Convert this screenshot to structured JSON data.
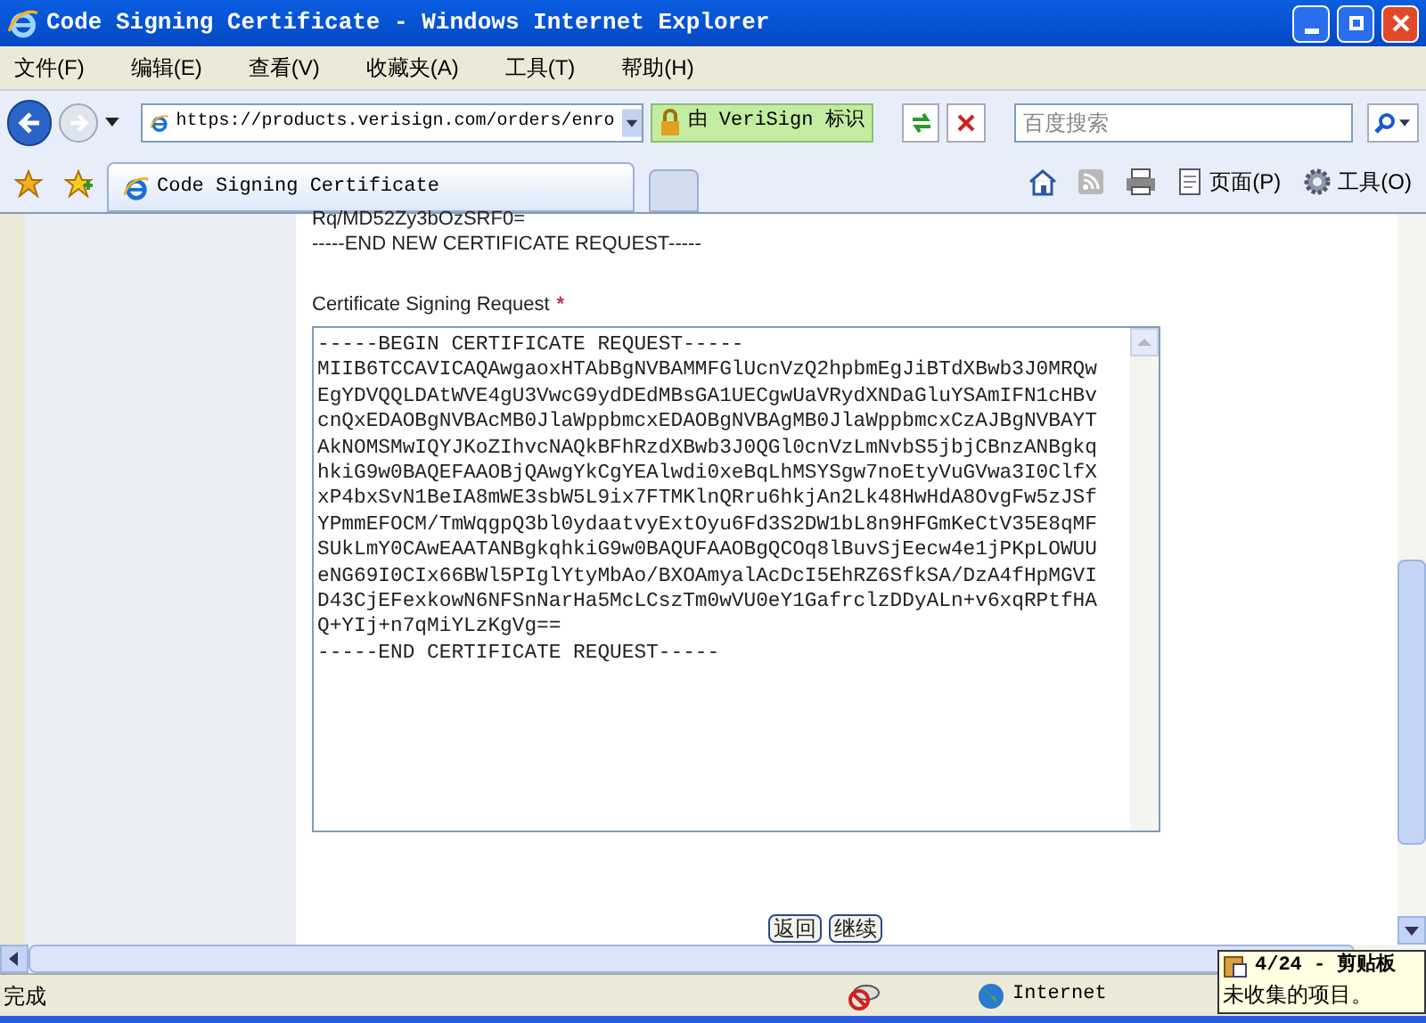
{
  "window": {
    "title": "Code Signing Certificate - Windows Internet Explorer"
  },
  "menu": [
    "文件(F)",
    "编辑(E)",
    "查看(V)",
    "收藏夹(A)",
    "工具(T)",
    "帮助(H)"
  ],
  "address": {
    "value": "https://products.verisign.com/orders/enro",
    "security": "由 VeriSign 标识"
  },
  "search": {
    "placeholder": "百度搜索"
  },
  "tabs": [
    {
      "label": "Code Signing Certificate",
      "selected": true
    }
  ],
  "command_bar": {
    "page": "页面(P)",
    "tools": "工具(O)"
  },
  "page": {
    "prev_lines": [
      "Rq/MD52Zy3bOzSRF0=",
      "-----END NEW CERTIFICATE REQUEST-----"
    ],
    "field_label": "Certificate Signing Request",
    "required_mark": "*",
    "csr_lines": [
      "-----BEGIN CERTIFICATE REQUEST-----",
      "MIIB6TCCAVICAQAwgaoxHTAbBgNVBAMMFGlUcnVzQ2hpbmEgJiBTdXBwb3J0MRQw",
      "EgYDVQQLDAtWVE4gU3VwcG9ydDEdMBsGA1UECgwUaVRydXNDaGluYSAmIFN1cHBv",
      "cnQxEDAOBgNVBAcMB0JlaWppbmcxEDAOBgNVBAgMB0JlaWppbmcxCzAJBgNVBAYT",
      "AkNOMSMwIQYJKoZIhvcNAQkBFhRzdXBwb3J0QGl0cnVzLmNvbS5jbjCBnzANBgkq",
      "hkiG9w0BAQEFAAOBjQAwgYkCgYEAlwdi0xeBqLhMSYSgw7noEtyVuGVwa3I0ClfX",
      "xP4bxSvN1BeIA8mWE3sbW5L9ix7FTMKlnQRru6hkjAn2Lk48HwHdA8OvgFw5zJSf",
      "YPmmEFOCM/TmWqgpQ3bl0ydaatvyExtOyu6Fd3S2DW1bL8n9HFGmKeCtV35E8qMF",
      "SUkLmY0CAwEAATANBgkqhkiG9w0BAQUFAAOBgQCOq8lBuvSjEecw4e1jPKpLOWUU",
      "eNG69I0CIx66BWl5PIglYtyMbAo/BXOAmyalAcDcI5EhRZ6SfkSA/DzA4fHpMGVI",
      "D43CjEFexkowN6NFSnNarHa5McLCszTm0wVU0eY1GafrclzDDyALn+v6xqRPtfHA",
      "Q+YIj+n7qMiYLzKgVg==",
      "-----END CERTIFICATE REQUEST-----"
    ],
    "buttons": [
      "返回",
      "继续"
    ]
  },
  "status_bar": {
    "text": "完成",
    "zone": "Internet"
  },
  "clipboard_popup": {
    "title": "4/24 - 剪贴板",
    "text": "未收集的项目。"
  }
}
